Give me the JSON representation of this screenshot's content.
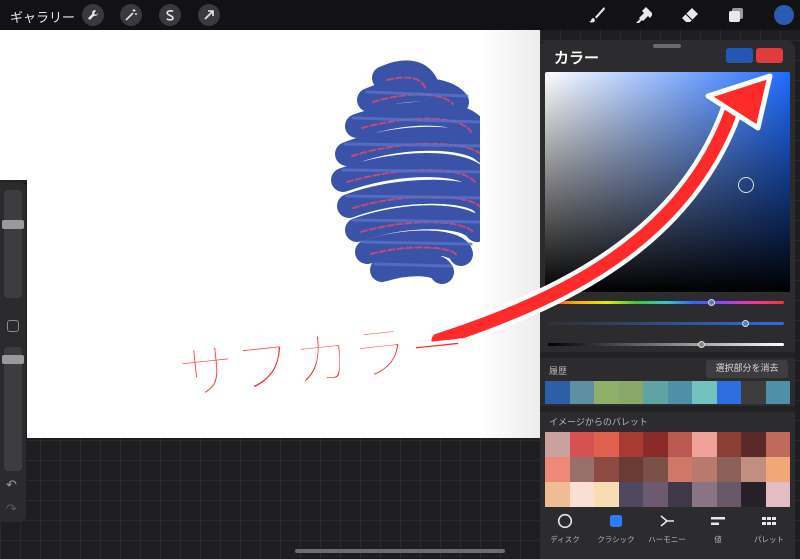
{
  "toolbar": {
    "gallery_label": "ギャラリー",
    "left_icons": [
      "wrench-icon",
      "magic-wand-icon",
      "selection-s-icon",
      "arrow-cursor-icon"
    ],
    "right_tools": [
      "brush-icon",
      "smudge-icon",
      "eraser-icon",
      "layers-icon"
    ],
    "current_color": "#2b5bb0"
  },
  "annotation": {
    "text": "サブカラー",
    "color": "#ff2a2a"
  },
  "color_panel": {
    "title": "カラー",
    "primary_color": "#2457b3",
    "secondary_color": "#e03c3c",
    "history_label": "履歴",
    "clear_label": "選択部分を消去",
    "history_colors": [
      "#2d5ea8",
      "#5f8fa2",
      "#8fb06a",
      "#8aa86a",
      "#5fa3a3",
      "#4f8fa8",
      "#74c2c0",
      "#2f6ee0",
      "#3d3d40",
      "#4f8fa8"
    ],
    "palette_label": "イメージからのパレット",
    "palette_colors": [
      "#c9a2a0",
      "#d55050",
      "#e06050",
      "#a83a34",
      "#8a2a2a",
      "#b85a50",
      "#efa098",
      "#8a3e34",
      "#5c2828",
      "#c06a5e",
      "#ee8878",
      "#98706a",
      "#8e4a42",
      "#6a3a34",
      "#7a5048",
      "#d07868",
      "#b87a6c",
      "#8a6058",
      "#c28e80",
      "#f0a878",
      "#f0bc96",
      "#fae0d4",
      "#f8dcb4",
      "#504860",
      "#6e5a70",
      "#403848",
      "#8a7484",
      "#685868",
      "#282028",
      "#e4bcc4"
    ],
    "tabs": [
      {
        "label": "ディスク",
        "icon": "disc-icon",
        "active": false
      },
      {
        "label": "クラシック",
        "icon": "classic-square-icon",
        "active": true
      },
      {
        "label": "ハーモニー",
        "icon": "harmony-icon",
        "active": false
      },
      {
        "label": "値",
        "icon": "value-sliders-icon",
        "active": false
      },
      {
        "label": "パレット",
        "icon": "palette-grid-icon",
        "active": false
      }
    ]
  }
}
